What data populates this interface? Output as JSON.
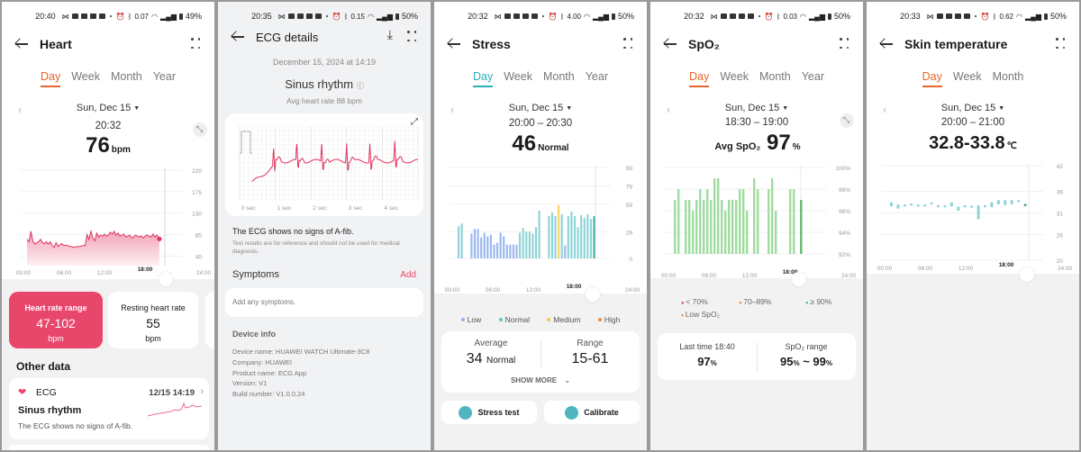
{
  "status_common": {
    "icons": [
      "notification-icons",
      "alarm-icon",
      "bluetooth-icon",
      "speed-icon",
      "wifi-icon",
      "signal-icon",
      "battery-icon"
    ]
  },
  "screens": [
    {
      "status": {
        "time": "20:40",
        "battery": "49%",
        "speed": "0.07"
      },
      "title": "Heart",
      "tabs": [
        "Day",
        "Week",
        "Month",
        "Year"
      ],
      "active_tab": "Day",
      "accent": "#e8652d",
      "date": "Sun, Dec 15",
      "time": "20:32",
      "value": "76",
      "unit": "bpm",
      "cards": [
        {
          "label": "Heart rate range",
          "value": "47-102",
          "unit": "bpm"
        },
        {
          "label": "Resting heart rate",
          "value": "55",
          "unit": "bpm"
        }
      ],
      "other_data_title": "Other data",
      "ecg_item": {
        "label": "ECG",
        "datetime": "12/15 14:19",
        "title": "Sinus rhythm",
        "desc": "The ECG shows no signs of A-fib."
      }
    },
    {
      "status": {
        "time": "20:35",
        "battery": "50%",
        "speed": "0.15"
      },
      "title": "ECG details",
      "datetime": "December 15, 2024 at 14:19",
      "rhythm": "Sinus rhythm",
      "avg": "Avg heart rate 88 bpm",
      "x_ticks": [
        "0 sec",
        "1 sec",
        "2 sec",
        "3 sec",
        "4 sec"
      ],
      "finding": "The ECG shows no signs of A-fib.",
      "disclaimer": "Test results are for reference and should not be used for medical diagnosis.",
      "symptoms_title": "Symptoms",
      "symptoms_add": "Add",
      "symptoms_placeholder": "Add any symptoms.",
      "device_info_title": "Device info",
      "device_info": [
        "Device name: HUAWEI WATCH Ultimate-3C8",
        "Company: HUAWEI",
        "Product name: ECG App",
        "Version: V1",
        "Build number: V1.0.0.24"
      ]
    },
    {
      "status": {
        "time": "20:32",
        "battery": "50%",
        "speed": "4.00"
      },
      "title": "Stress",
      "tabs": [
        "Day",
        "Week",
        "Month",
        "Year"
      ],
      "active_tab": "Day",
      "accent": "#2bb0b8",
      "date": "Sun, Dec 15",
      "range": "20:00 – 20:30",
      "value": "46",
      "level": "Normal",
      "legend": [
        {
          "label": "Low",
          "color": "#8fb2ee"
        },
        {
          "label": "Normal",
          "color": "#5cc4c7"
        },
        {
          "label": "Medium",
          "color": "#f6c94a"
        },
        {
          "label": "High",
          "color": "#f08a3c"
        }
      ],
      "average_label": "Average",
      "average_value": "34",
      "average_level": "Normal",
      "range_label": "Range",
      "range_value": "15-61",
      "show_more": "SHOW MORE",
      "buttons": [
        "Stress test",
        "Calibrate"
      ]
    },
    {
      "status": {
        "time": "20:32",
        "battery": "50%",
        "speed": "0.03"
      },
      "title": "SpO₂",
      "tabs": [
        "Day",
        "Week",
        "Month",
        "Year"
      ],
      "active_tab": "Day",
      "accent": "#e8652d",
      "date": "Sun, Dec 15",
      "range": "18:30 – 19:00",
      "avg_label": "Avg SpO₂",
      "value": "97",
      "unit": "%",
      "legend": [
        {
          "label": "< 70%",
          "color": "#e24b4b"
        },
        {
          "label": "70–89%",
          "color": "#f08a3c"
        },
        {
          "label": "≥ 90%",
          "color": "#5cc46a"
        },
        {
          "label": "Low SpO₂",
          "color": "#f08a3c"
        }
      ],
      "last_time_label": "Last time 18:40",
      "last_value": "97",
      "range_label": "SpO₂ range",
      "range_low": "95",
      "range_high": "99"
    },
    {
      "status": {
        "time": "20:33",
        "battery": "50%",
        "speed": "0.62"
      },
      "title": "Skin temperature",
      "tabs": [
        "Day",
        "Week",
        "Month"
      ],
      "active_tab": "Day",
      "accent": "#e8652d",
      "date": "Sun, Dec 15",
      "range": "20:00 – 21:00",
      "value": "32.8-33.8",
      "unit": "℃"
    }
  ],
  "chart_data": [
    {
      "type": "line",
      "title": "Heart rate (Day)",
      "x_ticks": [
        "00:00",
        "06:00",
        "12:00",
        "18:00",
        "24:00"
      ],
      "y_ticks": [
        40,
        85,
        130,
        175,
        220
      ],
      "ylim": [
        20,
        220
      ],
      "x_range_hours": [
        0,
        24
      ],
      "series": [
        {
          "name": "bpm",
          "x": [
            0,
            0.3,
            0.6,
            0.9,
            1.2,
            1.5,
            1.8,
            2.1,
            2.4,
            2.7,
            3,
            3.3,
            3.6,
            3.9,
            4.2,
            4.5,
            4.8,
            5.1,
            5.4,
            5.7,
            6,
            6.3,
            6.6,
            6.9,
            7.2,
            7.5,
            7.8,
            8.1,
            8.4,
            8.7,
            9,
            9.3,
            9.6,
            9.9,
            10.2,
            10.5,
            10.8,
            11.1,
            11.4,
            11.7,
            12,
            12.3,
            12.6,
            12.9,
            13.2,
            13.5,
            13.8,
            14.1,
            14.4,
            14.7,
            15,
            15.3,
            15.6,
            15.9,
            16.2,
            16.5,
            16.8,
            17.1,
            17.4,
            17.7,
            18,
            18.3,
            18.6,
            18.9,
            19.2,
            19.5,
            19.8,
            20.1,
            20.5
          ],
          "values": [
            75,
            70,
            92,
            72,
            65,
            68,
            70,
            75,
            68,
            66,
            70,
            65,
            70,
            62,
            58,
            68,
            60,
            64,
            66,
            62,
            63,
            62,
            60,
            60,
            58,
            59,
            60,
            60,
            61,
            62,
            62,
            85,
            75,
            92,
            78,
            72,
            88,
            80,
            84,
            82,
            86,
            82,
            84,
            90,
            86,
            92,
            84,
            88,
            82,
            84,
            86,
            80,
            82,
            84,
            78,
            80,
            84,
            82,
            80,
            82,
            78,
            82,
            84,
            82,
            80,
            86,
            80,
            84,
            76
          ]
        }
      ]
    },
    {
      "type": "line",
      "title": "ECG",
      "xlabel": "sec",
      "x_ticks": [
        "0 sec",
        "1 sec",
        "2 sec",
        "3 sec",
        "4 sec"
      ],
      "xlim": [
        0,
        5
      ]
    },
    {
      "type": "bar",
      "title": "Stress (Day)",
      "x_ticks": [
        "00:00",
        "06:00",
        "12:00",
        "18:00",
        "24:00"
      ],
      "y_ticks": [
        0,
        29,
        59,
        79,
        99
      ],
      "ylim": [
        0,
        99
      ],
      "values": [
        35,
        38,
        null,
        null,
        27,
        32,
        32,
        23,
        28,
        24,
        26,
        15,
        17,
        28,
        24,
        15,
        15,
        15,
        15,
        28,
        33,
        29,
        29,
        27,
        34,
        52,
        null,
        null,
        46,
        50,
        46,
        58,
        48,
        14,
        46,
        51,
        46,
        34,
        47,
        44,
        48,
        43,
        46
      ],
      "levels": [
        "N",
        "N",
        null,
        null,
        "L",
        "L",
        "L",
        "L",
        "L",
        "L",
        "L",
        "L",
        "L",
        "L",
        "L",
        "L",
        "L",
        "L",
        "L",
        "N",
        "N",
        "N",
        "N",
        "N",
        "N",
        "N",
        null,
        null,
        "N",
        "N",
        "N",
        "M",
        "N",
        "L",
        "N",
        "N",
        "N",
        "N",
        "N",
        "N",
        "N",
        "N",
        "S"
      ]
    },
    {
      "type": "bar",
      "title": "SpO₂ (Day)",
      "x_ticks": [
        "00:00",
        "06:00",
        "12:00",
        "18:00",
        "24:00"
      ],
      "y_ticks": [
        "92%",
        "94%",
        "96%",
        "98%",
        "100%"
      ],
      "ylim": [
        92,
        100
      ],
      "values": [
        97,
        98,
        null,
        97,
        97,
        96,
        97,
        98,
        97,
        98,
        97,
        99,
        99,
        97,
        96,
        97,
        97,
        97,
        98,
        98,
        96,
        null,
        99,
        98,
        null,
        null,
        98,
        99,
        96,
        null,
        null,
        null,
        98,
        98,
        null,
        97
      ],
      "selected_index": 35
    },
    {
      "type": "scatter",
      "title": "Skin temperature (Day)",
      "x_ticks": [
        "00:00",
        "06:00",
        "12:00",
        "18:00",
        "24:00"
      ],
      "y_ticks": [
        20,
        26,
        31,
        36,
        42
      ],
      "ylim": [
        20,
        42
      ],
      "ranges": [
        [
          32.5,
          33.5
        ],
        [
          32,
          33
        ],
        [
          32.5,
          33
        ],
        [
          32.8,
          33.2
        ],
        [
          32.6,
          33
        ],
        [
          32.6,
          33
        ],
        [
          33.2,
          33.5
        ],
        [
          32.5,
          32.8
        ],
        [
          32.5,
          32.8
        ],
        [
          32.5,
          33.5
        ],
        [
          31.5,
          32.5
        ],
        [
          32.3,
          32.8
        ],
        [
          32.4,
          32.7
        ],
        [
          29.5,
          32.8
        ],
        [
          32.4,
          32.8
        ],
        [
          32.3,
          33.5
        ],
        [
          33,
          34
        ],
        [
          32.8,
          34
        ],
        [
          33,
          34
        ],
        [
          33.5,
          34
        ],
        [
          32.8,
          33.1
        ]
      ]
    }
  ]
}
